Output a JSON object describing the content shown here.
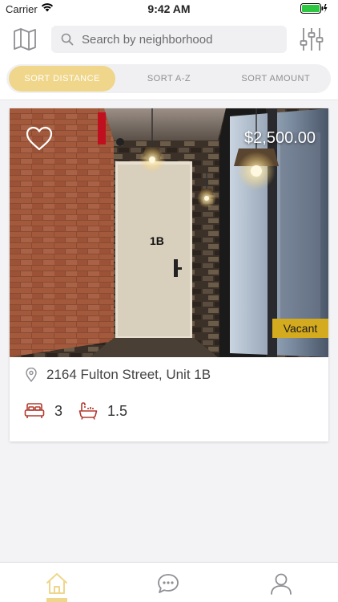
{
  "status_bar": {
    "carrier": "Carrier",
    "time": "9:42 AM",
    "battery_level": 1.0
  },
  "header": {
    "map_icon": "map-icon",
    "search": {
      "placeholder": "Search by neighborhood",
      "value": "",
      "icon": "search-icon"
    },
    "filter_icon": "sliders-icon"
  },
  "sort": {
    "tabs": [
      {
        "label": "SORT DISTANCE",
        "active": true
      },
      {
        "label": "SORT A-Z",
        "active": false
      },
      {
        "label": "SORT AMOUNT",
        "active": false
      }
    ]
  },
  "listings": [
    {
      "price": "$2,500.00",
      "status": "Vacant",
      "address": "2164 Fulton Street, Unit 1B",
      "door_label": "1B",
      "beds": "3",
      "baths": "1.5",
      "favorite": false
    }
  ],
  "tab_bar": {
    "items": [
      {
        "icon": "home-icon",
        "active": true
      },
      {
        "icon": "chat-icon",
        "active": false
      },
      {
        "icon": "profile-icon",
        "active": false
      }
    ]
  },
  "colors": {
    "accent": "#efd68a",
    "badge": "#d4aa1f",
    "spec_icon": "#b23a2e",
    "icon_gray": "#8e8e93"
  }
}
